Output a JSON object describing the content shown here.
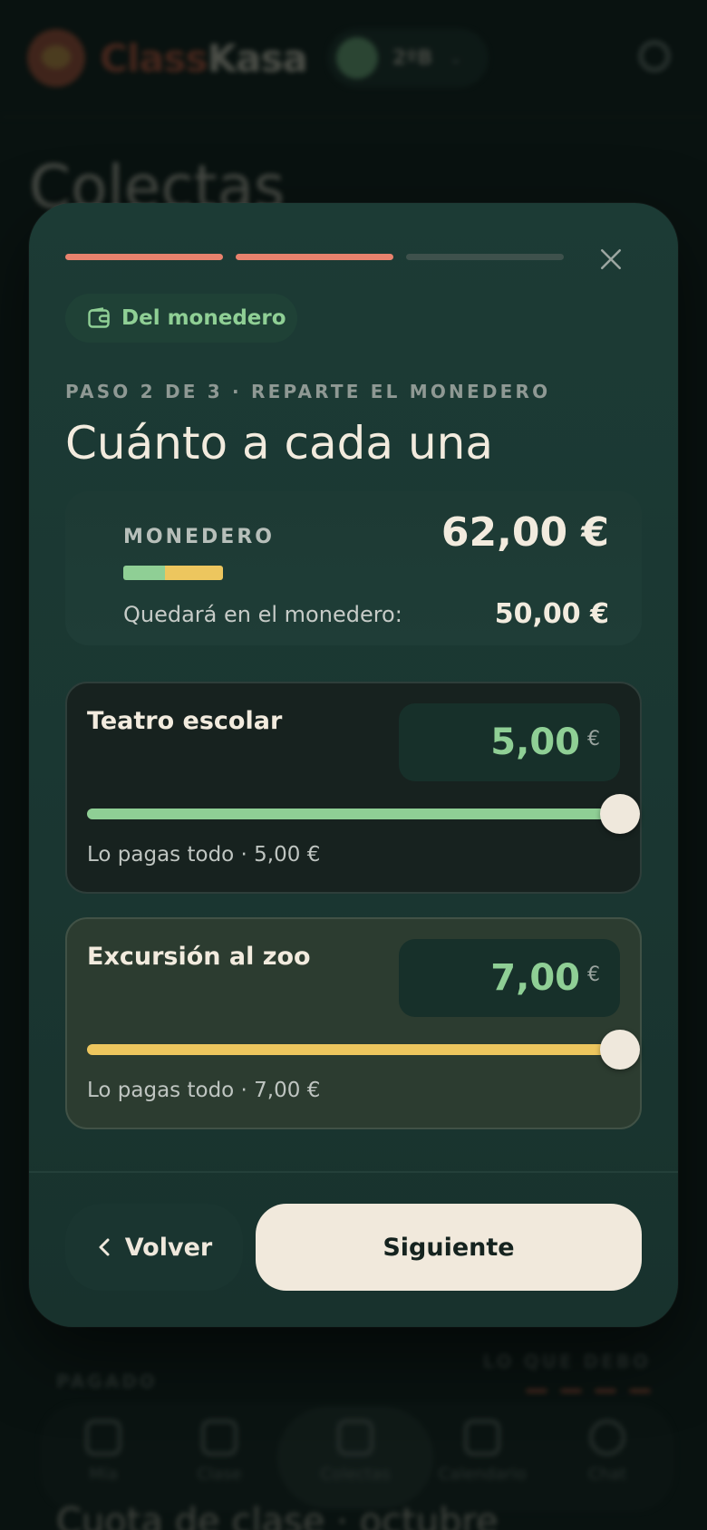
{
  "background": {
    "brand_part1": "Class",
    "brand_part2": "Kasa",
    "class_selector": "2ºB",
    "page_title": "Colectas",
    "left_caption": "PAGADO",
    "right_caption": "LO QUE DEBO",
    "bottom_text": "Cuota de clase · octubre",
    "nav": [
      {
        "label": "Mía"
      },
      {
        "label": "Clase"
      },
      {
        "label": "Colectas"
      },
      {
        "label": "Calendario"
      },
      {
        "label": "Chat"
      }
    ]
  },
  "modal": {
    "progress": {
      "current_step": 2,
      "total_steps": 3
    },
    "source_pill": "Del monedero",
    "step_label": "PASO 2 DE 3 · REPARTE EL MONEDERO",
    "heading": "Cuánto a cada una",
    "wallet": {
      "label": "MONEDERO",
      "total": "62,00 €",
      "remaining_label": "Quedará en el monedero:",
      "remaining": "50,00 €",
      "usage_bar_colors": {
        "teatro": "#8fcf95",
        "zoo": "#edc65e"
      }
    },
    "allocations": [
      {
        "name": "Teatro escolar",
        "amount": "5,00",
        "currency": "€",
        "slider_fraction": 1.0,
        "color": "#8fcf95",
        "note": "Lo pagas todo · 5,00 €"
      },
      {
        "name": "Excursión al zoo",
        "amount": "7,00",
        "currency": "€",
        "slider_fraction": 1.0,
        "color": "#edc65e",
        "note": "Lo pagas todo · 7,00 €"
      }
    ],
    "back_label": "Volver",
    "next_label": "Siguiente"
  },
  "colors": {
    "accent_progress": "#e8826d",
    "accent_green": "#8fcf95",
    "accent_yellow": "#edc65e",
    "button_light": "#f1e9dc"
  }
}
